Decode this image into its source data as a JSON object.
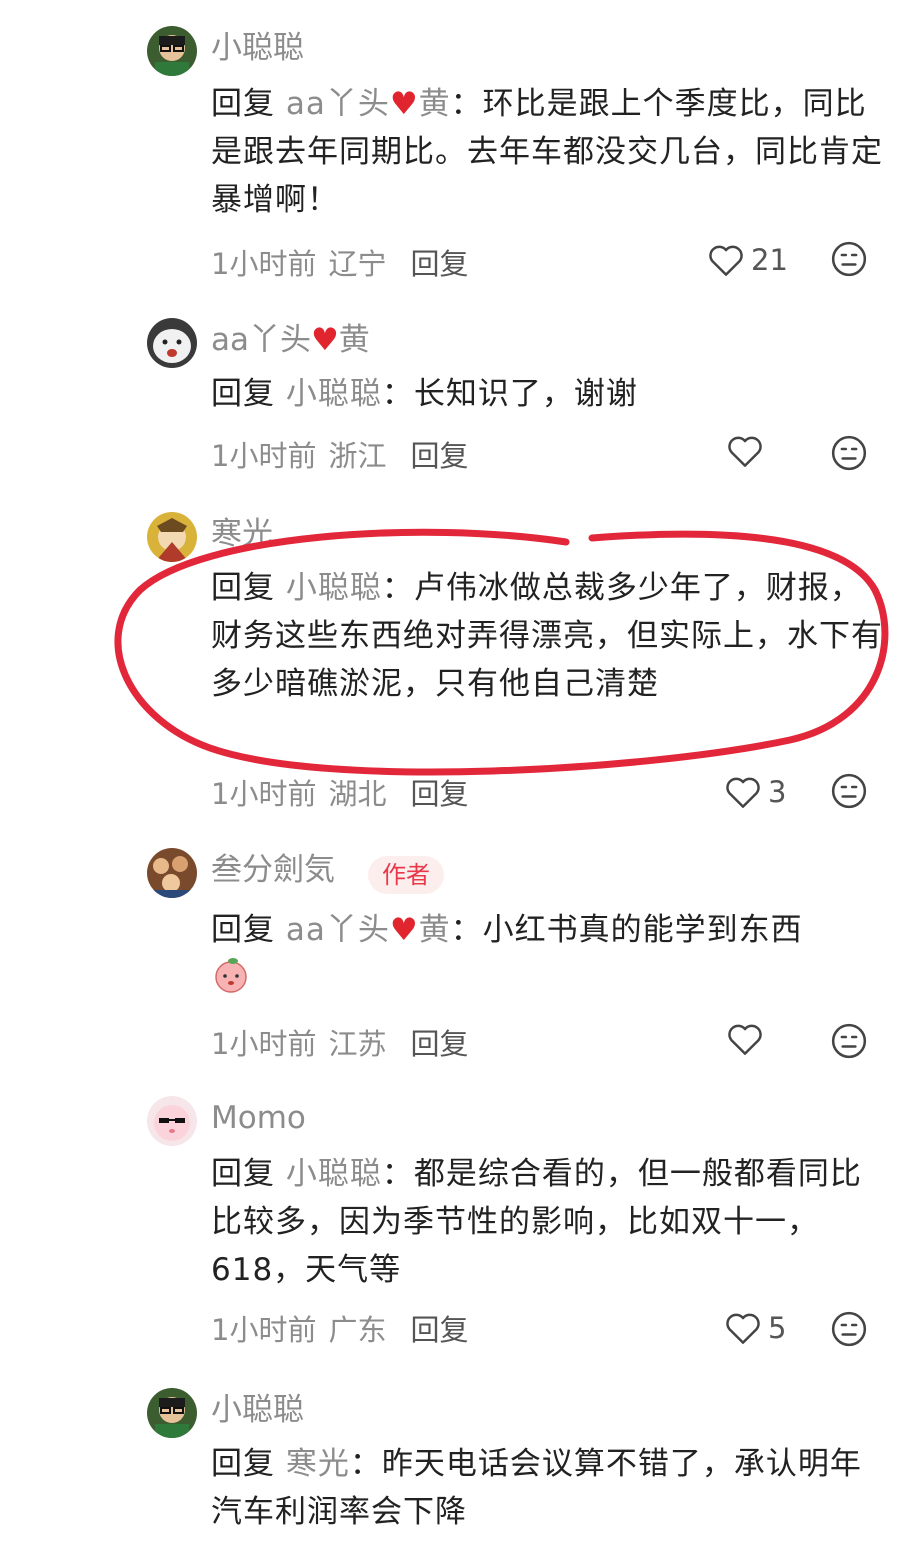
{
  "comments": [
    {
      "user": "小聪聪",
      "reply_prefix": "回复",
      "reply_to": "aa丫头",
      "reply_to_suffix": "黄",
      "text": "：环比是跟上个季度比，同比是跟去年同期比。去年车都没交几台，同比肯定暴增啊！",
      "time": "1小时前",
      "location": "辽宁",
      "reply_label": "回复",
      "likes": "21"
    },
    {
      "user": "aa丫头",
      "user_suffix": "黄",
      "reply_prefix": "回复",
      "reply_to": "小聪聪",
      "text": "：长知识了，谢谢",
      "time": "1小时前",
      "location": "浙江",
      "reply_label": "回复",
      "likes": ""
    },
    {
      "user": "寒光",
      "reply_prefix": "回复",
      "reply_to": "小聪聪",
      "text": "：卢伟冰做总裁多少年了，财报，财务这些东西绝对弄得漂亮，但实际上，水下有多少暗礁淤泥，只有他自己清楚",
      "time": "1小时前",
      "location": "湖北",
      "reply_label": "回复",
      "likes": "3"
    },
    {
      "user": "叁分劍気",
      "badge": "作者",
      "reply_prefix": "回复",
      "reply_to": "aa丫头",
      "reply_to_suffix": "黄",
      "text": "：小红书真的能学到东西",
      "time": "1小时前",
      "location": "江苏",
      "reply_label": "回复",
      "likes": ""
    },
    {
      "user": "Momo",
      "reply_prefix": "回复",
      "reply_to": "小聪聪",
      "text": "：都是综合看的，但一般都看同比比较多，因为季节性的影响，比如双十一，618，天气等",
      "time": "1小时前",
      "location": "广东",
      "reply_label": "回复",
      "likes": "5"
    },
    {
      "user": "小聪聪",
      "reply_prefix": "回复",
      "reply_to": "寒光",
      "text": "：昨天电话会议算不错了，承认明年汽车利润率会下降"
    }
  ],
  "colors": {
    "annotation_circle": "#e3273a",
    "badge_text": "#e8384a",
    "badge_bg": "#fdeeee",
    "muted": "#8c8c8c"
  },
  "icons": [
    "heart-outline-icon",
    "dislike-face-icon",
    "red-heart-emoji",
    "peach-emoji"
  ]
}
